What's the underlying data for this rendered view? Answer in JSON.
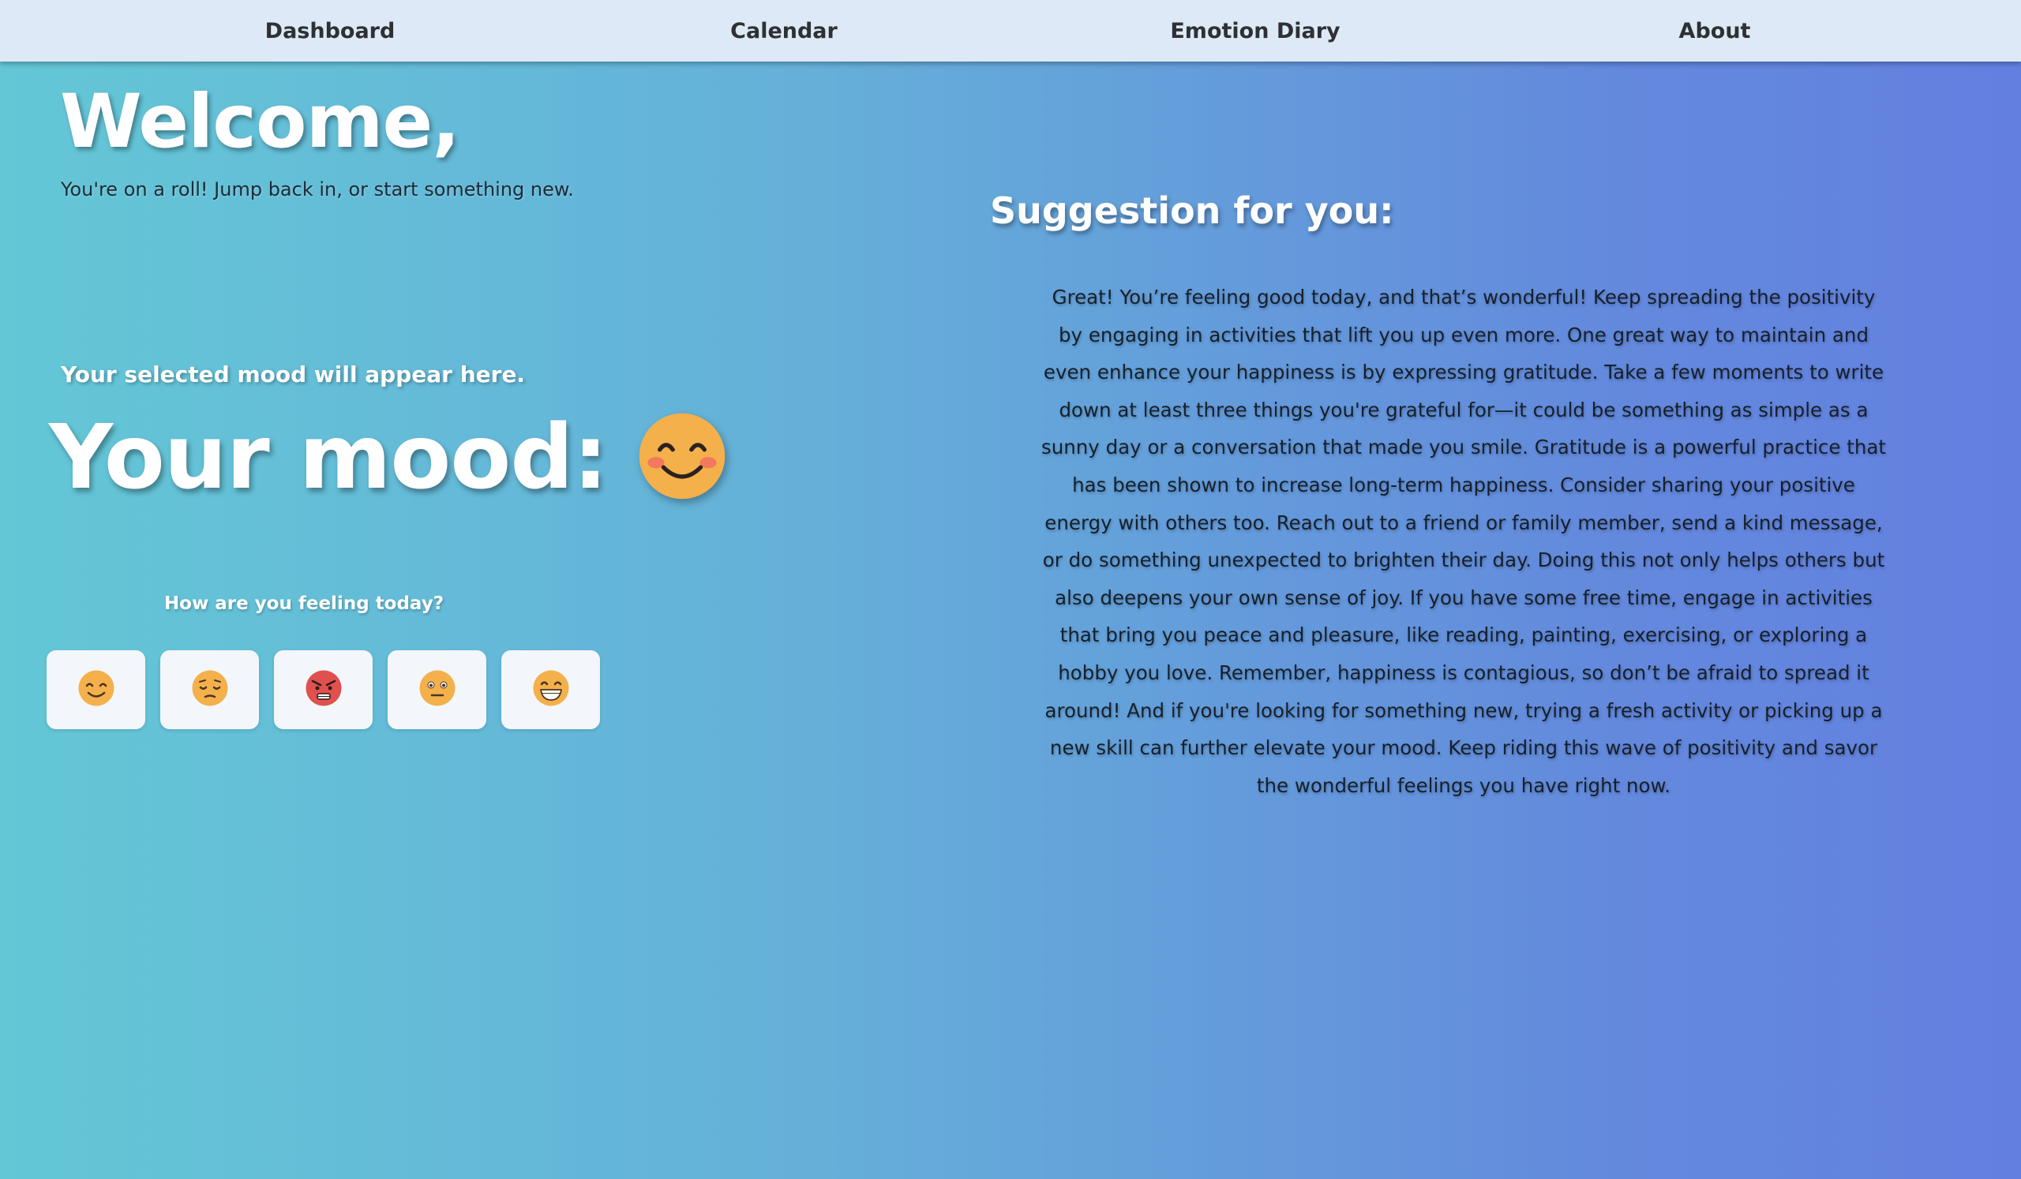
{
  "nav": {
    "items": [
      {
        "label": "Dashboard"
      },
      {
        "label": "Calendar"
      },
      {
        "label": "Emotion Diary"
      },
      {
        "label": "About"
      }
    ]
  },
  "welcome": {
    "title": "Welcome,",
    "subtitle": "You're on a roll! Jump back in, or start something new."
  },
  "mood": {
    "hint": "Your selected mood will appear here.",
    "label": "Your mood:",
    "current_icon": "smiling-blush-emoji-icon",
    "question": "How are you feeling today?",
    "options": [
      {
        "icon": "smiling-face-icon"
      },
      {
        "icon": "pensive-face-icon"
      },
      {
        "icon": "angry-face-icon"
      },
      {
        "icon": "neutral-face-icon"
      },
      {
        "icon": "grinning-face-icon"
      }
    ]
  },
  "suggestion": {
    "title": "Suggestion for you:",
    "text": "Great! You’re feeling good today, and that’s wonderful! Keep spreading the positivity by engaging in activities that lift you up even more. One great way to maintain and even enhance your happiness is by expressing gratitude. Take a few moments to write down at least three things you're grateful for—it could be something as simple as a sunny day or a conversation that made you smile. Gratitude is a powerful practice that has been shown to increase long-term happiness. Consider sharing your positive energy with others too. Reach out to a friend or family member, send a kind message, or do something unexpected to brighten their day. Doing this not only helps others but also deepens your own sense of joy. If you have some free time, engage in activities that bring you peace and pleasure, like reading, painting, exercising, or exploring a hobby you love. Remember, happiness is contagious, so don’t be afraid to spread it around! And if you're looking for something new, trying a fresh activity or picking up a new skill can further elevate your mood. Keep riding this wave of positivity and savor the wonderful feelings you have right now."
  },
  "colors": {
    "nav_bg": "#dde9f6",
    "gradient_start": "#63c7d6",
    "gradient_end": "#6380e0",
    "emoji_yellow": "#f4b04b",
    "angry_red": "#e0504e"
  }
}
